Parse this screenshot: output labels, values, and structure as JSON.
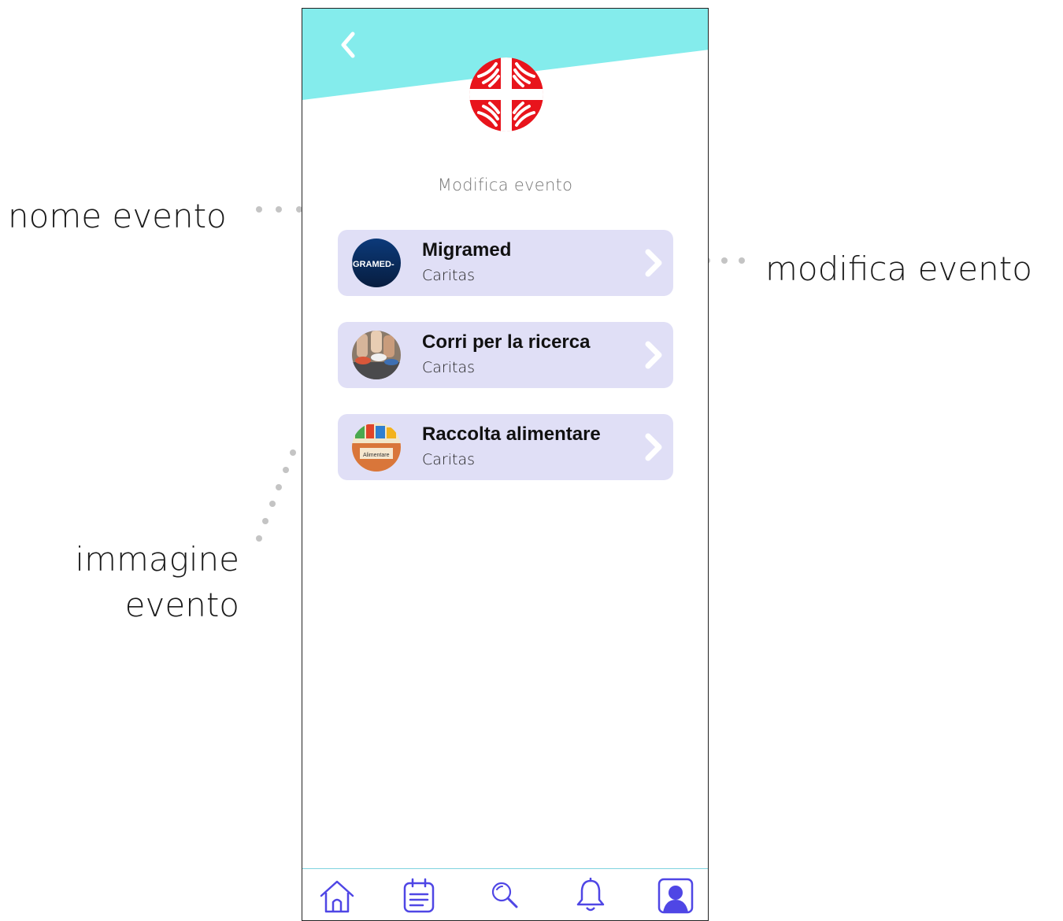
{
  "annotations": {
    "event_name": "nome evento",
    "edit_event": "modifica evento",
    "event_image_line1": "immagine",
    "event_image_line2": "evento"
  },
  "header": {
    "page_title": "Modifica evento",
    "back_icon": "chevron-left-icon",
    "logo": "caritas-logo",
    "accent_color": "#84ecec"
  },
  "events": [
    {
      "name": "Migramed",
      "org": "Caritas",
      "thumb_text": "IGRAMED-"
    },
    {
      "name": "Corri per la ricerca",
      "org": "Caritas"
    },
    {
      "name": "Raccolta alimentare",
      "org": "Caritas",
      "thumb_text": "Alimentare"
    }
  ],
  "colors": {
    "card_bg": "#e0dff6",
    "nav_icon": "#4f46e5",
    "logo_red": "#e8141c"
  },
  "nav": {
    "items": [
      "home-icon",
      "calendar-list-icon",
      "search-icon",
      "bell-icon",
      "profile-icon"
    ],
    "active": "profile-icon"
  }
}
